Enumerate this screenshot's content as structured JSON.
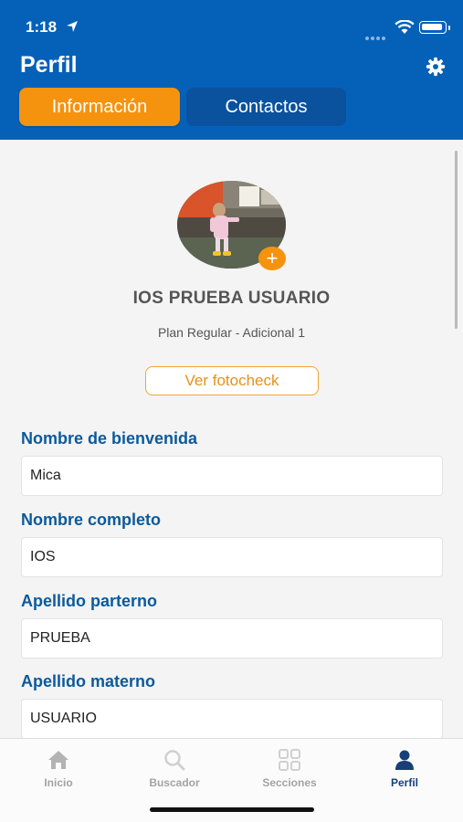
{
  "status_bar": {
    "time": "1:18"
  },
  "header": {
    "title": "Perfil",
    "tabs": [
      {
        "label": "Información",
        "active": true
      },
      {
        "label": "Contactos",
        "active": false
      }
    ]
  },
  "profile": {
    "name": "IOS PRUEBA USUARIO",
    "plan": "Plan Regular - Adicional 1",
    "fotocheck_label": "Ver fotocheck",
    "add_photo_symbol": "+"
  },
  "form": {
    "fields": [
      {
        "label": "Nombre de bienvenida",
        "value": "Mica"
      },
      {
        "label": "Nombre completo",
        "value": "IOS"
      },
      {
        "label": "Apellido parterno",
        "value": "PRUEBA"
      },
      {
        "label": "Apellido materno",
        "value": "USUARIO"
      }
    ]
  },
  "tabbar": {
    "items": [
      {
        "label": "Inicio",
        "icon": "home-icon",
        "active": false
      },
      {
        "label": "Buscador",
        "icon": "search-icon",
        "active": false
      },
      {
        "label": "Secciones",
        "icon": "grid-icon",
        "active": false
      },
      {
        "label": "Perfil",
        "icon": "person-icon",
        "active": true
      }
    ]
  },
  "colors": {
    "header_bg": "#0561b8",
    "accent_orange": "#f5930f",
    "label_blue": "#0b5a9c",
    "tab_active": "#17407a"
  }
}
